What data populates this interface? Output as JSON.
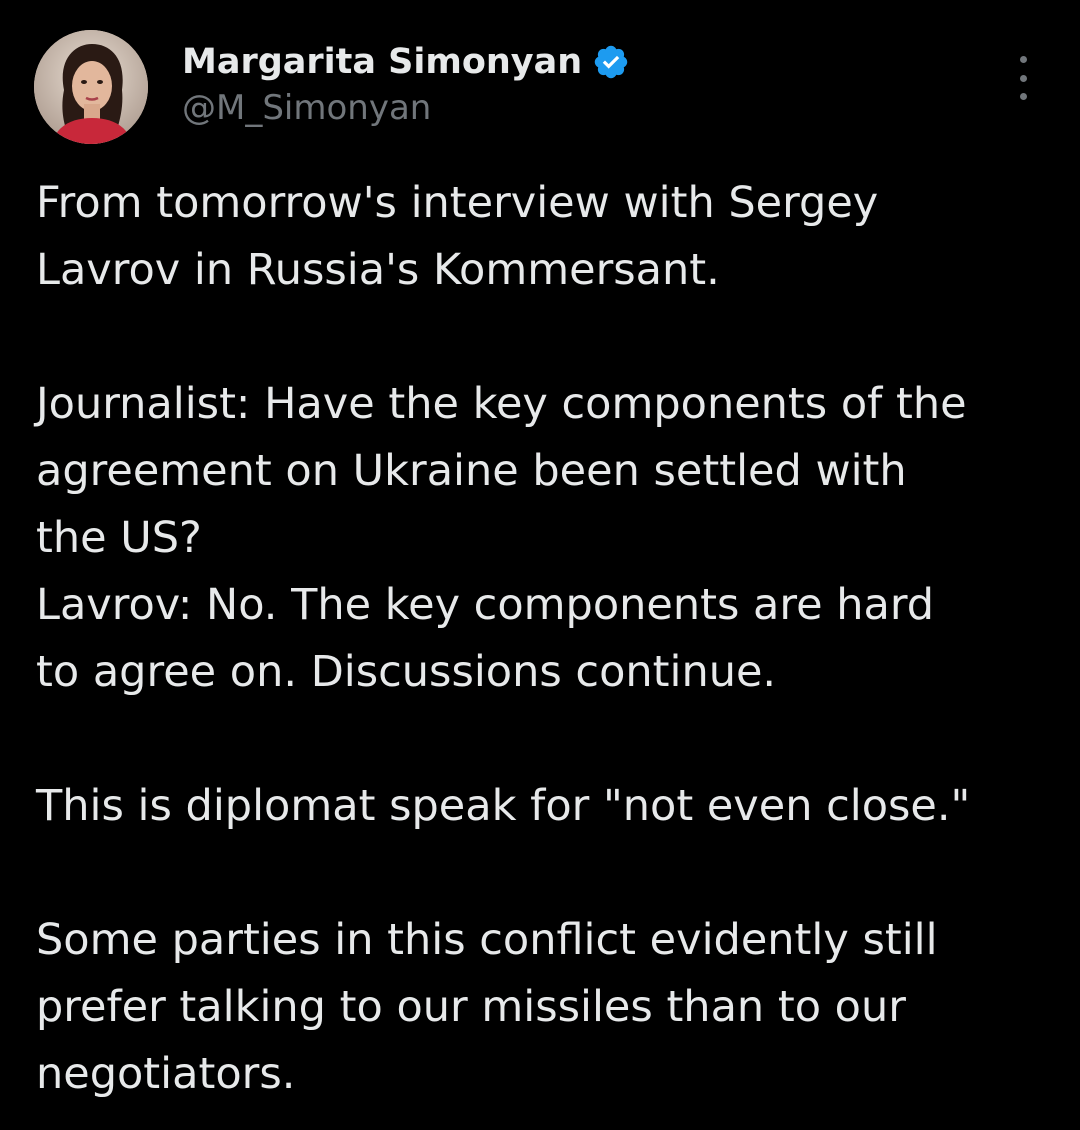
{
  "author": {
    "display_name": "Margarita Simonyan",
    "handle": "@M_Simonyan",
    "verified": true,
    "verified_color": "#1d9bf0"
  },
  "icons": {
    "avatar": "profile-photo",
    "verified": "verified-badge-icon",
    "more": "more-options-icon"
  },
  "tweet": {
    "lines": [
      "From tomorrow's interview with Sergey",
      "Lavrov in Russia's Kommersant.",
      "",
      "Journalist: Have the key components of the",
      "agreement on Ukraine been settled with",
      "the US?",
      "Lavrov: No. The key components are hard",
      "to agree on. Discussions continue.",
      "",
      "This is diplomat speak for \"not even close.\"",
      "",
      "Some parties in this conflict evidently still",
      "prefer talking to our missiles than to our",
      "negotiators."
    ]
  },
  "colors": {
    "background": "#000000",
    "text": "#e7e9ea",
    "secondary_text": "#71767b"
  }
}
